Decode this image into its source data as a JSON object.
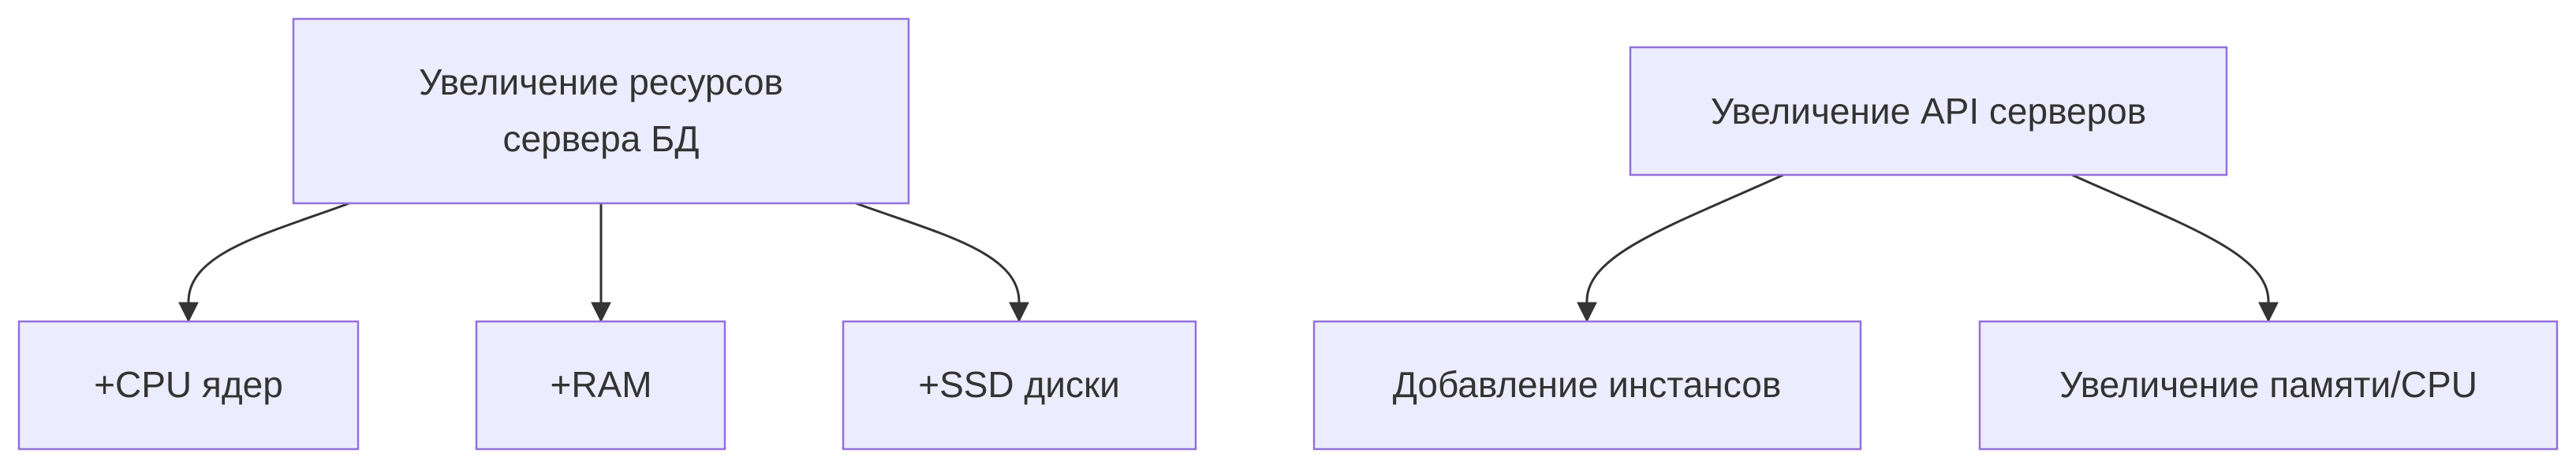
{
  "diagram": {
    "nodes": {
      "db_scale": {
        "lines": [
          "Увеличение ресурсов",
          "сервера БД"
        ]
      },
      "cpu": {
        "label": "+CPU ядер"
      },
      "ram": {
        "label": "+RAM"
      },
      "ssd": {
        "label": "+SSD диски"
      },
      "api_scale": {
        "label": "Увеличение API серверов"
      },
      "add_instances": {
        "label": "Добавление инстансов"
      },
      "mem_cpu": {
        "label": "Увеличение памяти/CPU"
      }
    },
    "edges": [
      {
        "from": "db_scale",
        "to": "cpu"
      },
      {
        "from": "db_scale",
        "to": "ram"
      },
      {
        "from": "db_scale",
        "to": "ssd"
      },
      {
        "from": "api_scale",
        "to": "add_instances"
      },
      {
        "from": "api_scale",
        "to": "mem_cpu"
      }
    ],
    "colors": {
      "node_fill": "#ECECFF",
      "node_stroke": "#9370DB",
      "edge": "#333333",
      "text": "#333333"
    }
  }
}
